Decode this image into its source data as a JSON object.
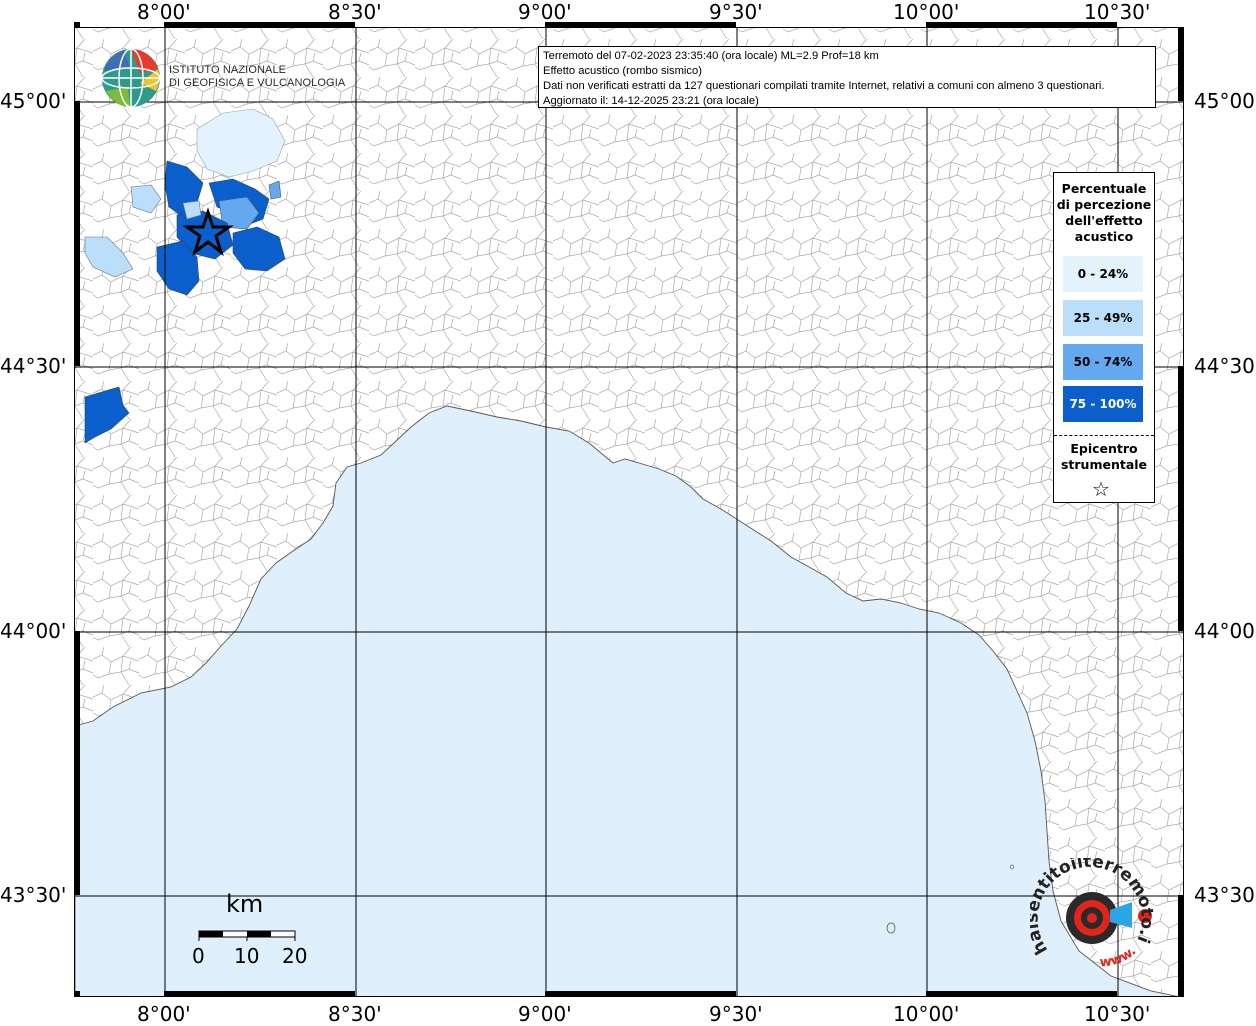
{
  "header": {
    "line1": "Terremoto del 07-02-2023 23:35:40 (ora locale) ML=2.9 Prof=18 km",
    "line2": "Effetto acustico (rombo sismico)",
    "line3": "Dati non verificati estratti da 127 questionari compilati tramite Internet, relativi a comuni con almeno 3 questionari.",
    "line4": "Aggiornato il: 14-12-2025 23:21 (ora locale)"
  },
  "institute": {
    "line1": "ISTITUTO NAZIONALE",
    "line2": "DI GEOFISICA E VULCANOLOGIA"
  },
  "axes": {
    "longitude_labels": [
      "8°00'",
      "8°30'",
      "9°00'",
      "9°30'",
      "10°00'",
      "10°30'"
    ],
    "latitude_labels": [
      "45°00'",
      "44°30'",
      "44°00'",
      "43°30'"
    ]
  },
  "legend": {
    "title": "Percentuale di percezione dell'effetto acustico",
    "classes": [
      {
        "label": "0 - 24%",
        "color": "#e3f2fd"
      },
      {
        "label": "25 - 49%",
        "color": "#bbdefb"
      },
      {
        "label": "50 - 74%",
        "color": "#64a8f0"
      },
      {
        "label": "75 - 100%",
        "color": "#0b5fcc"
      }
    ],
    "epicenter_label": "Epicentro strumentale",
    "epicenter_symbol": "☆"
  },
  "scale_bar": {
    "unit": "km",
    "ticks": [
      "0",
      "10",
      "20"
    ]
  },
  "colors": {
    "sea": "#dff0fc",
    "land": "#ffffff",
    "border_lines": "#9e9e9e",
    "grid": "#000000"
  },
  "brand": {
    "text": "haisentitoilterremoto.it",
    "www": "www."
  }
}
